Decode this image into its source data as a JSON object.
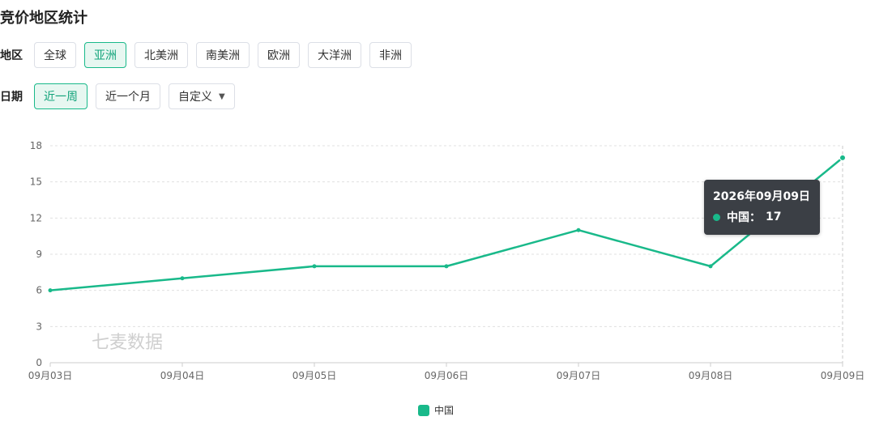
{
  "page": {
    "title": "竞价地区统计"
  },
  "filters": {
    "region": {
      "label": "地区",
      "options": [
        "全球",
        "亚洲",
        "北美洲",
        "南美洲",
        "欧洲",
        "大洋洲",
        "非洲"
      ],
      "selected": "亚洲"
    },
    "date": {
      "label": "日期",
      "options": [
        "近一周",
        "近一个月",
        "自定义"
      ],
      "selected": "近一周",
      "custom_has_dropdown": true
    }
  },
  "colors": {
    "accent": "#19b98a",
    "grid": "#e0e0e0",
    "tooltip_bg": "#3b3f45"
  },
  "icons": {
    "dropdown": "caret-down-icon"
  },
  "watermark": "七麦数据",
  "tooltip": {
    "title": "2026年09月09日",
    "series": "中国",
    "value": "17"
  },
  "chart_data": {
    "type": "line",
    "categories": [
      "09月03日",
      "09月04日",
      "09月05日",
      "09月06日",
      "09月07日",
      "09月08日",
      "09月09日"
    ],
    "series": [
      {
        "name": "中国",
        "values": [
          6,
          7,
          8,
          8,
          11,
          8,
          17
        ]
      }
    ],
    "ylim": [
      0,
      18
    ],
    "yticks": [
      0,
      3,
      6,
      9,
      12,
      15,
      18
    ],
    "grid": true,
    "legend": "bottom-center",
    "title": "",
    "xlabel": "",
    "ylabel": ""
  }
}
